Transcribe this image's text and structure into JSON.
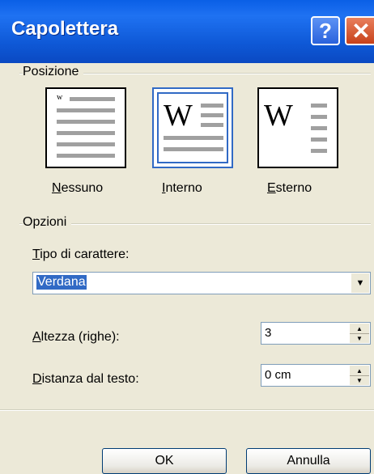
{
  "window": {
    "title": "Capolettera"
  },
  "titlebar": {
    "help_symbol": "?",
    "close_symbol": "✕",
    "help_icon": "help-icon",
    "close_icon": "close-icon"
  },
  "posizione": {
    "label": "Posizione",
    "options": [
      {
        "id": "nessuno",
        "label_first": "N",
        "label_rest": "essuno",
        "selected": false
      },
      {
        "id": "interno",
        "label_first": "I",
        "label_rest": "nterno",
        "selected": true
      },
      {
        "id": "esterno",
        "label_first": "E",
        "label_rest": "sterno",
        "selected": false
      }
    ],
    "preview_letter": "W",
    "preview_small_letter": "w"
  },
  "opzioni": {
    "label": "Opzioni",
    "font_label_first": "T",
    "font_label_rest": "ipo di carattere:",
    "font_value": "Verdana",
    "height_label_first": "A",
    "height_label_rest": "ltezza (righe):",
    "height_value": "3",
    "distance_label_first": "D",
    "distance_label_rest": "istanza dal testo:",
    "distance_value": "0 cm"
  },
  "buttons": {
    "ok": "OK",
    "cancel": "Annulla"
  },
  "colors": {
    "title_bar": "#0A5FE6",
    "selection": "#316AC5",
    "dialog_bg": "#ECE9D8",
    "close_button": "#D5572E"
  }
}
